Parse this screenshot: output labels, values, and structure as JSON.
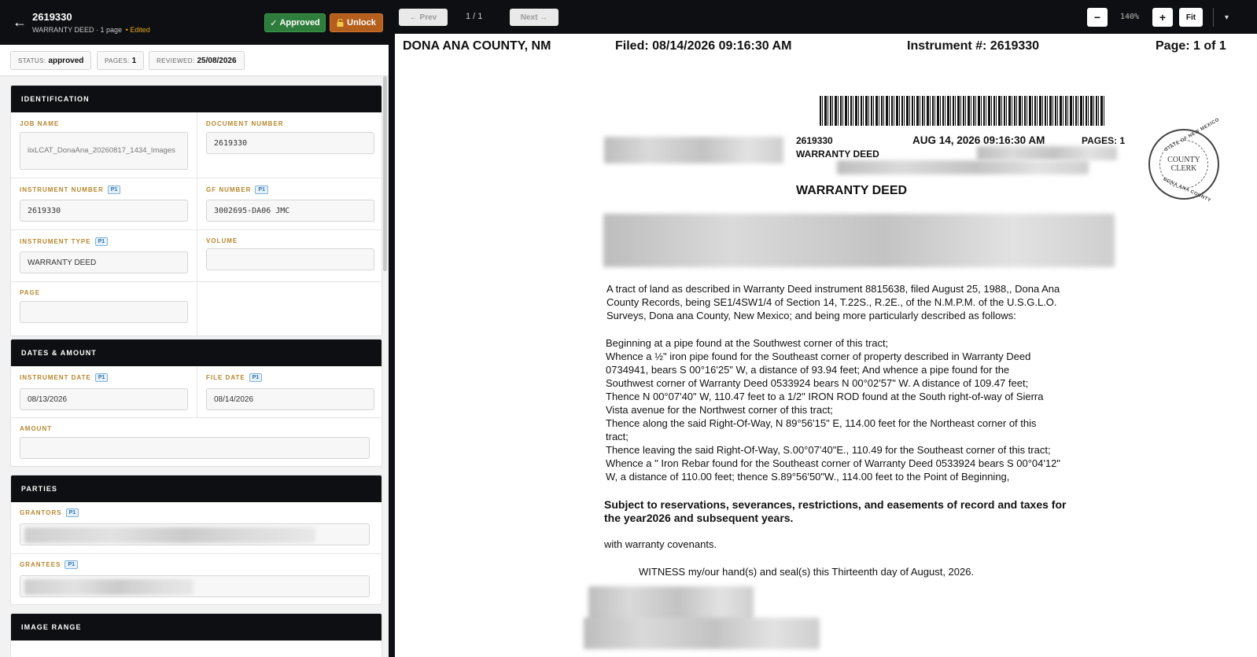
{
  "header": {
    "back_glyph": "←",
    "title": "2619330",
    "subtitle": "WARRANTY DEED · 1 page",
    "edited": "• Edited",
    "approved_label": "Approved",
    "unlock_label": "Unlock"
  },
  "chips": {
    "status_label": "STATUS:",
    "status_value": "approved",
    "pages_label": "PAGES:",
    "pages_value": "1",
    "reviewed_label": "REVIEWED:",
    "reviewed_value": "25/08/2026"
  },
  "identification": {
    "title": "IDENTIFICATION",
    "job_name_label": "JOB NAME",
    "job_name_value": "iixLCAT_DonaAna_20260817_1434_Images",
    "document_number_label": "DOCUMENT NUMBER",
    "document_number_value": "2619330",
    "instrument_number_label": "INSTRUMENT NUMBER",
    "instrument_number_value": "2619330",
    "gf_number_label": "GF NUMBER",
    "gf_number_value": "3002695-DA06 JMC",
    "instrument_type_label": "INSTRUMENT TYPE",
    "instrument_type_value": "WARRANTY DEED",
    "volume_label": "VOLUME",
    "volume_value": "",
    "page_label": "PAGE",
    "page_value": ""
  },
  "dates": {
    "title": "DATES & AMOUNT",
    "instrument_date_label": "INSTRUMENT DATE",
    "instrument_date_value": "08/13/2026",
    "file_date_label": "FILE DATE",
    "file_date_value": "08/14/2026",
    "amount_label": "AMOUNT",
    "amount_value": ""
  },
  "parties": {
    "title": "PARTIES",
    "grantors_label": "GRANTORS",
    "grantees_label": "GRANTEES"
  },
  "image_range": {
    "title": "IMAGE RANGE"
  },
  "badge_p1": "P1",
  "viewer": {
    "prev_label": "← Prev",
    "page_indicator": "1 / 1",
    "next_label": "Next →",
    "zoom_out": "−",
    "zoom_level": "140%",
    "zoom_in": "+",
    "fit_label": "Fit"
  },
  "document": {
    "county": "DONA ANA COUNTY, NM",
    "filed": "Filed: 08/14/2026  09:16:30 AM",
    "instrument": "Instrument #: 2619330",
    "page": "Page: 1 of 1",
    "doc_no": "2619330",
    "doc_datetime": "AUG 14, 2026 09:16:30 AM",
    "doc_pages": "PAGES: 1",
    "doc_type": "WARRANTY DEED",
    "heading": "WARRANTY DEED",
    "stamp_center": "COUNTY\nCLERK",
    "stamp_top": "STATE OF NEW MEXICO",
    "stamp_bottom": "DONA ANA COUNTY",
    "legal_lines": [
      "A tract of land as described in Warranty Deed instrument 8815638, filed August 25, 1988,, Dona Ana",
      "County Records, being SE1/4SW1/4 of Section 14, T.22S., R.2E., of the N.M.P.M. of the U.S.G.L.O.",
      "Surveys, Dona ana County, New Mexico; and being more particularly described as follows:"
    ],
    "metes_lines": [
      "Beginning at a pipe found at the Southwest corner of this tract;",
      "Whence a ½\" iron pipe found for the Southeast corner of property described in Warranty Deed",
      "0734941, bears S 00°16'25\" W, a distance of 93.94 feet; And whence a pipe found for the",
      "Southwest corner of Warranty Deed 0533924 bears N 00°02'57\" W. A distance of 109.47 feet;",
      "Thence N 00°07'40\" W, 110.47 feet to a 1/2\" IRON ROD found at the South right-of-way of Sierra",
      "Vista avenue for the Northwest corner of this tract;",
      "Thence along the said Right-Of-Way, N 89°56'15\" E, 114.00 feet for the Northeast corner of this",
      "tract;",
      "Thence leaving the said Right-Of-Way, S.00°07'40\"E., 110.49 for the Southeast corner of this tract;",
      "Whence a \" Iron Rebar found for the Southeast corner of Warranty Deed 0533924 bears S 00°04'12\"",
      "W, a distance of 110.00 feet; thence S.89°56'50\"W., 114.00 feet to the Point of Beginning,"
    ],
    "subject_lines": [
      "Subject to reservations, severances, restrictions, and easements of record and taxes for",
      "the year2026 and subsequent years."
    ],
    "covenants": "with warranty covenants.",
    "witness": "WITNESS my/our hand(s) and seal(s) this Thirteenth day of August, 2026."
  }
}
